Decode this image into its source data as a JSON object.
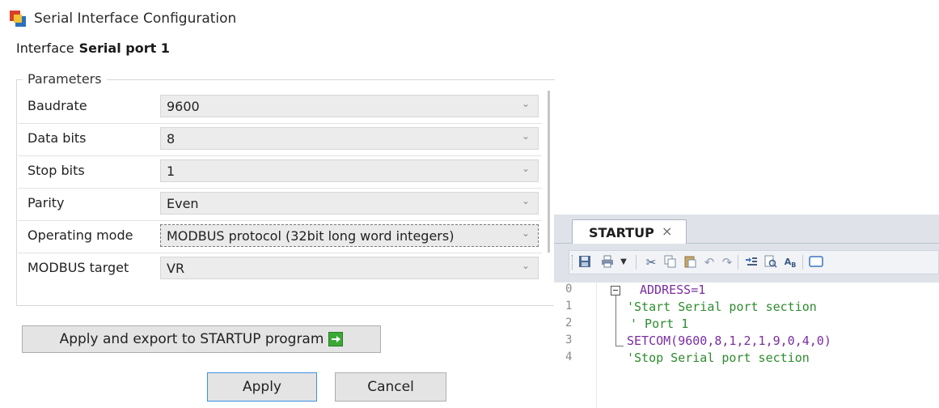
{
  "window": {
    "title": "Serial Interface Configuration"
  },
  "interface": {
    "label": "Interface",
    "value": "Serial port 1"
  },
  "parameters": {
    "legend": "Parameters",
    "rows": [
      {
        "label": "Baudrate",
        "value": "9600"
      },
      {
        "label": "Data bits",
        "value": "8"
      },
      {
        "label": "Stop bits",
        "value": "1"
      },
      {
        "label": "Parity",
        "value": "Even"
      },
      {
        "label": "Operating mode",
        "value": "MODBUS protocol (32bit long word integers)"
      },
      {
        "label": "MODBUS target",
        "value": "VR"
      }
    ]
  },
  "buttons": {
    "export": "Apply and export to STARTUP program",
    "apply": "Apply",
    "cancel": "Cancel"
  },
  "editor": {
    "tab_title": "STARTUP",
    "tab_close": "×",
    "lines": [
      {
        "num": "0",
        "text": "ADDRESS=1",
        "style": "kw"
      },
      {
        "num": "1",
        "text": "'Start Serial port section",
        "style": "cm"
      },
      {
        "num": "2",
        "text": "' Port 1",
        "style": "cm"
      },
      {
        "num": "3",
        "text": "SETCOM(9600,8,1,2,1,9,0,4,0)",
        "style": "kw"
      },
      {
        "num": "4",
        "text": "'Stop Serial port section",
        "style": "cm"
      }
    ]
  },
  "colors": {
    "keyword": "#7a2da0",
    "comment": "#2e8b2e",
    "primary_border": "#3c8fdf"
  },
  "icons": [
    "app-icon",
    "save-icon",
    "print-icon",
    "cut-icon",
    "copy-icon",
    "paste-icon",
    "undo-icon",
    "redo-icon",
    "indent-icon",
    "find-icon",
    "replace-icon",
    "window-icon",
    "export-arrow-icon"
  ]
}
